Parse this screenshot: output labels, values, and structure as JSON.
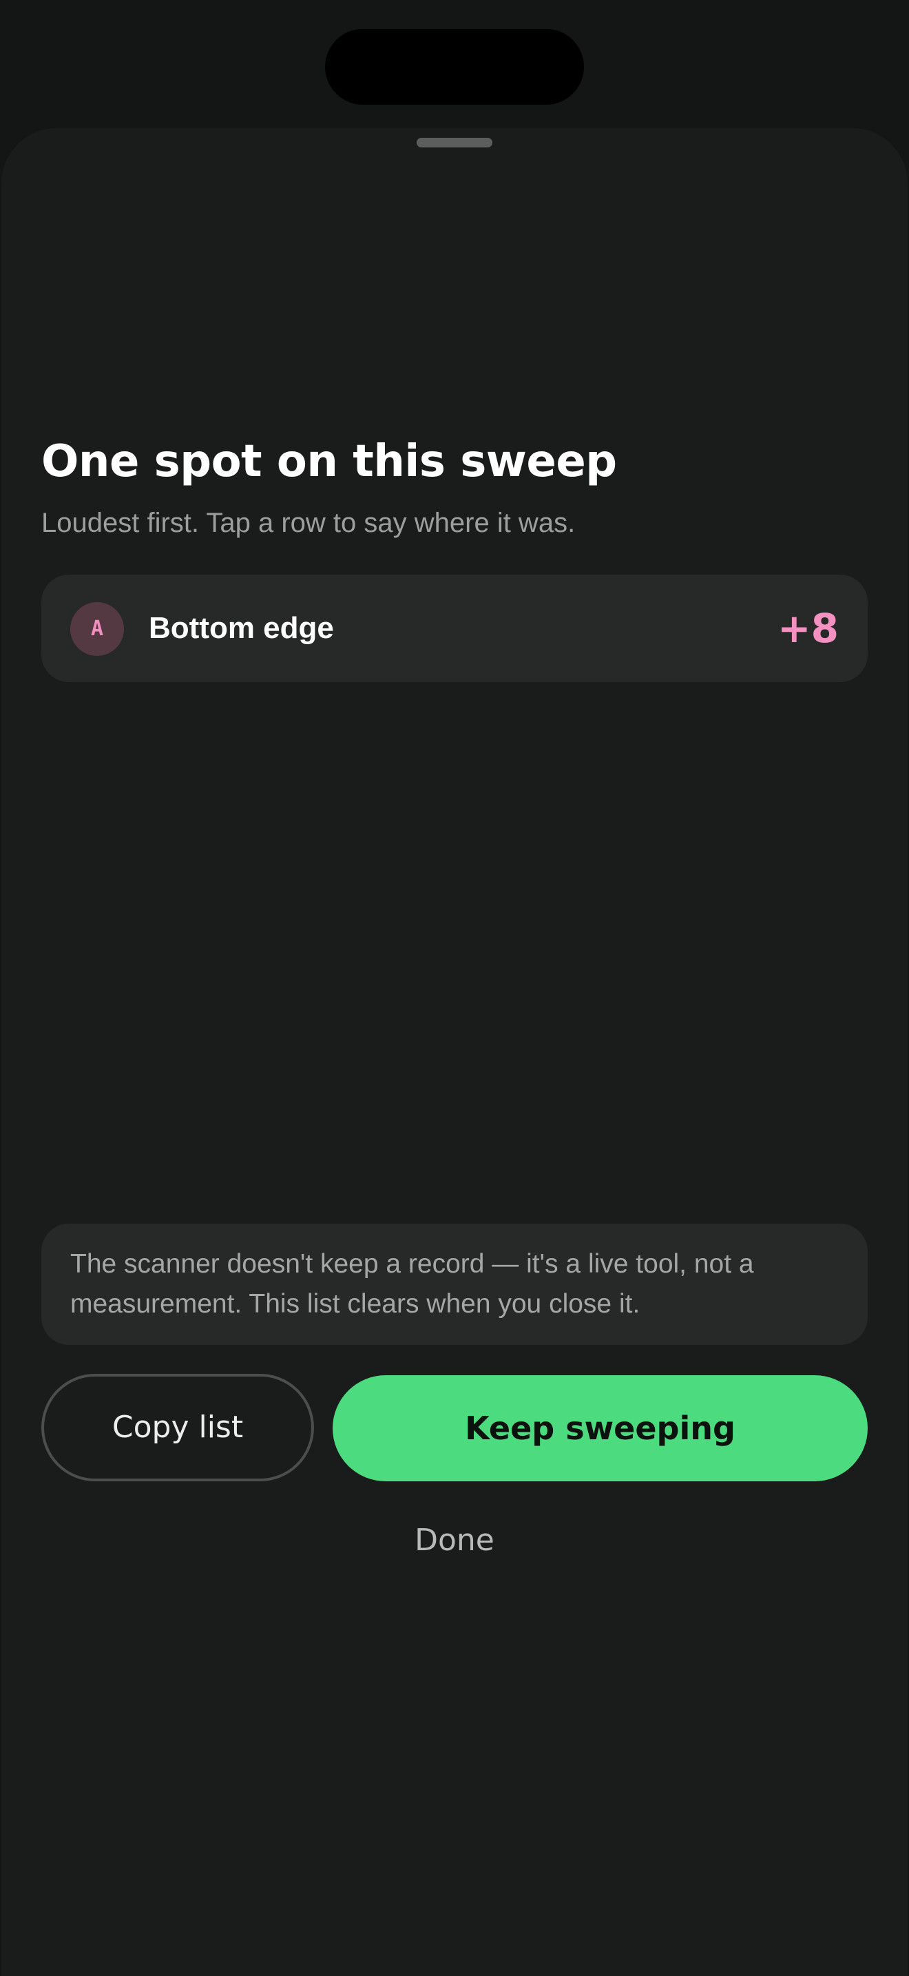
{
  "sheet": {
    "title": "One spot on this sweep",
    "subtitle": "Loudest first. Tap a row to say where it was.",
    "spots": [
      {
        "badge": "A",
        "label": "Bottom edge",
        "value": "+8"
      }
    ],
    "notice": "The scanner doesn't keep a record — it's a live tool, not a measurement. This list clears when you close it.",
    "actions": {
      "copy_label": "Copy list",
      "keep_label": "Keep sweeping",
      "done_label": "Done"
    }
  },
  "colors": {
    "background": "#141515",
    "sheet": "#1a1b1b",
    "card": "#272828",
    "accent_green": "#4cdb7f",
    "accent_pink": "#f391c1",
    "badge_bg": "#553942"
  },
  "icons": {
    "sheet_grabber": "grabber-handle-icon"
  }
}
